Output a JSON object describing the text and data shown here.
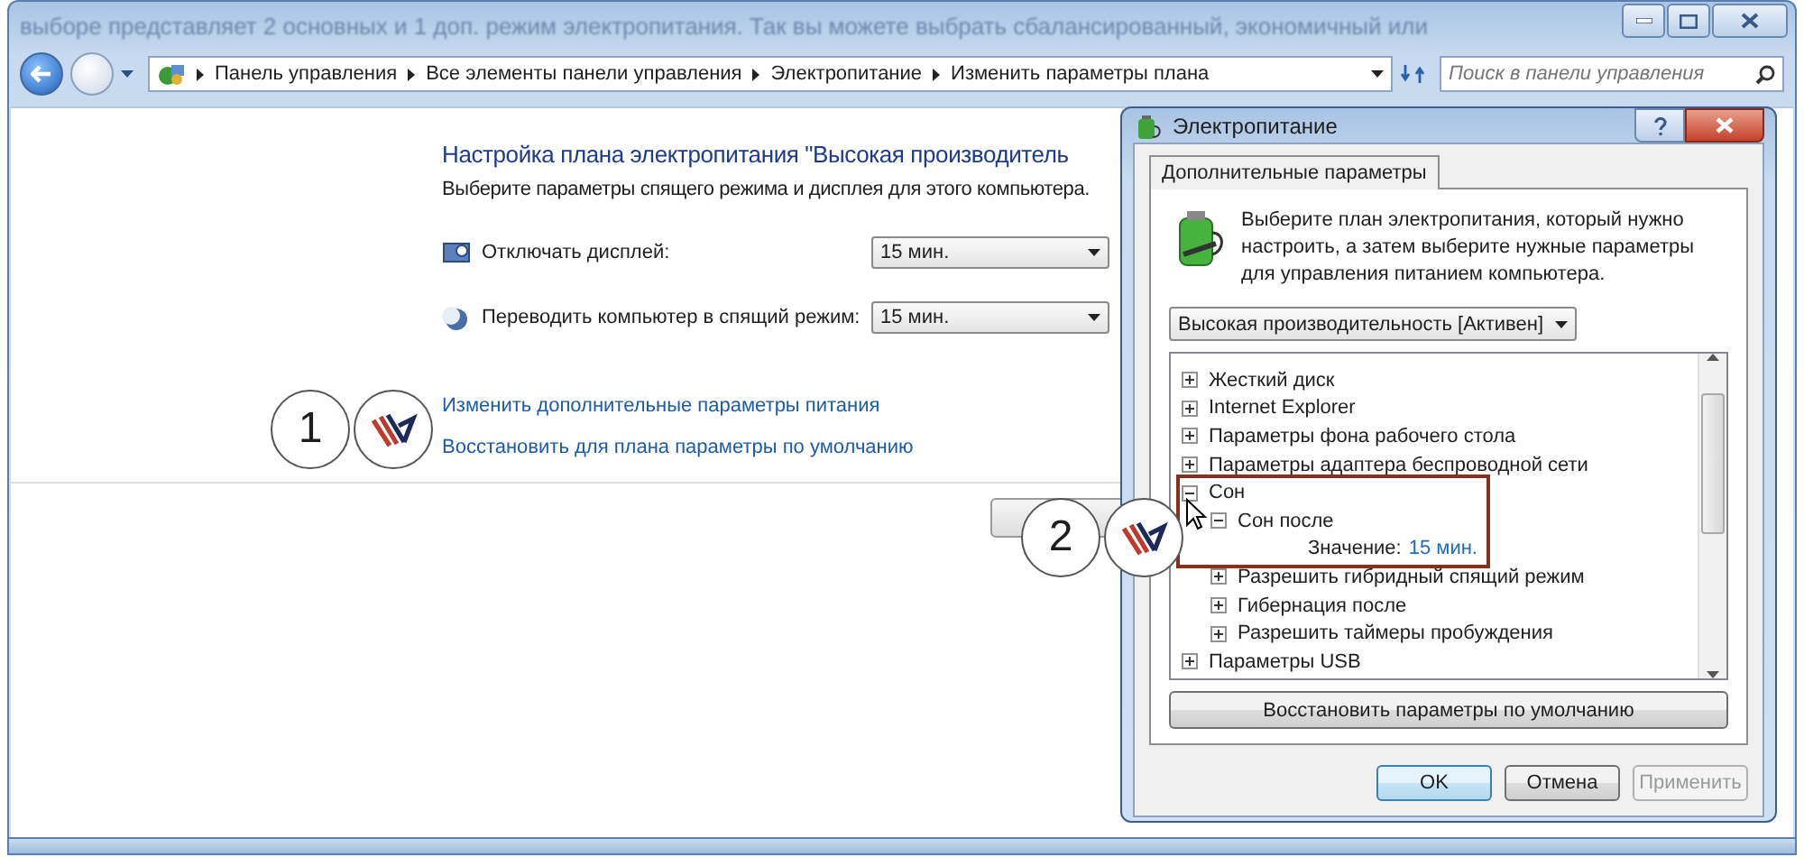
{
  "background_text": "выборе представляет 2 основных и 1 доп. режим электропитания. Так вы можете выбрать сбалансированный, экономичный или",
  "address_bar": {
    "breadcrumbs": [
      "Панель управления",
      "Все элементы панели управления",
      "Электропитание",
      "Изменить параметры плана"
    ]
  },
  "search": {
    "placeholder": "Поиск в панели управления"
  },
  "main": {
    "title": "Настройка плана электропитания \"Высокая производитель",
    "subtitle": "Выберите параметры спящего режима и дисплея для этого компьютера.",
    "settings": [
      {
        "kind": "display",
        "label": "Отключать дисплей:",
        "value": "15 мин."
      },
      {
        "kind": "sleep",
        "label": "Переводить компьютер в спящий режим:",
        "value": "15 мин."
      }
    ],
    "links": [
      "Изменить дополнительные параметры питания",
      "Восстановить для плана параметры по умолчанию"
    ]
  },
  "annotations": [
    {
      "number": "1"
    },
    {
      "number": "2"
    }
  ],
  "dialog": {
    "title": "Электропитание",
    "tabs": [
      {
        "label": "Дополнительные параметры",
        "selected": true
      }
    ],
    "description": "Выберите план электропитания, который нужно настроить, а затем выберите нужные параметры для управления питанием компьютера.",
    "plan": "Высокая производительность [Активен]",
    "tree": [
      {
        "kind": "group",
        "label": "Жесткий диск",
        "expanded": false
      },
      {
        "kind": "group",
        "label": "Internet Explorer",
        "expanded": false
      },
      {
        "kind": "group",
        "label": "Параметры фона рабочего стола",
        "expanded": false
      },
      {
        "kind": "group",
        "label": "Параметры адаптера беспроводной сети",
        "expanded": false
      },
      {
        "kind": "group",
        "label": "Сон",
        "expanded": true,
        "children": [
          {
            "kind": "group",
            "label": "Сон после",
            "expanded": true,
            "children": [
              {
                "kind": "value",
                "label": "Значение:",
                "value": "15 мин."
              }
            ]
          },
          {
            "kind": "group",
            "label": "Разрешить гибридный спящий режим",
            "expanded": false
          },
          {
            "kind": "group",
            "label": "Гибернация после",
            "expanded": false
          },
          {
            "kind": "group",
            "label": "Разрешить таймеры пробуждения",
            "expanded": false
          }
        ]
      },
      {
        "kind": "group",
        "label": "Параметры USB",
        "expanded": false
      }
    ],
    "restore_button": "Восстановить параметры по умолчанию",
    "buttons": [
      {
        "label": "OK",
        "default": true,
        "disabled": false
      },
      {
        "label": "Отмена",
        "default": false,
        "disabled": false
      },
      {
        "label": "Применить",
        "default": false,
        "disabled": true
      }
    ]
  }
}
